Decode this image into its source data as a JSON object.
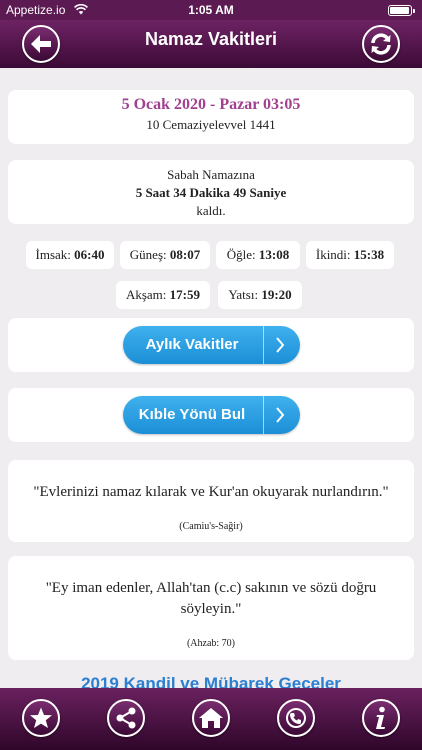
{
  "status_bar": {
    "carrier": "Appetize.io",
    "time": "1:05 AM"
  },
  "header": {
    "title": "Namaz Vakitleri",
    "back_icon": "back-arrow-icon",
    "refresh_icon": "refresh-icon"
  },
  "date_card": {
    "gregorian": "5 Ocak 2020 - Pazar 03:05",
    "hijri": "10 Cemaziyelevvel 1441"
  },
  "countdown": {
    "prayer": "Sabah Namazına",
    "remaining": "5 Saat 34 Dakika 49 Saniye",
    "suffix": "kaldı."
  },
  "prayer_times": [
    {
      "label": "İmsak:",
      "time": "06:40"
    },
    {
      "label": "Güneş:",
      "time": "08:07"
    },
    {
      "label": "Öğle:",
      "time": "13:08"
    },
    {
      "label": "İkindi:",
      "time": "15:38"
    },
    {
      "label": "Akşam:",
      "time": "17:59"
    },
    {
      "label": "Yatsı:",
      "time": "19:20"
    }
  ],
  "buttons": {
    "monthly": "Aylık Vakitler",
    "qibla": "Kıble Yönü Bul"
  },
  "quotes": [
    {
      "text": "\"Evlerinizi namaz kılarak ve Kur'an okuyarak nurlandırın.\"",
      "source": "(Camiu's-Sağir)"
    },
    {
      "text": "\"Ey iman edenler, Allah'tan (c.c) sakının ve sözü doğru söyleyin.\"",
      "source": "(Ahzab: 70)"
    }
  ],
  "kandil_link": "2019 Kandil ve Mübarek Geceler",
  "tab_bar": [
    "star-icon",
    "share-icon",
    "home-icon",
    "contact-icon",
    "info-icon"
  ],
  "colors": {
    "header": "#5c1a52",
    "date_accent": "#a0408f",
    "button_blue": "#2a9be2",
    "link_blue": "#2a7fd0",
    "background": "#efedf0"
  }
}
